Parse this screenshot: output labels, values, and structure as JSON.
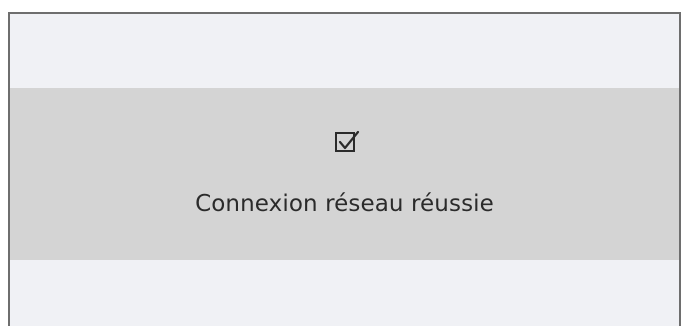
{
  "notification": {
    "icon": "checkbox-checked-icon",
    "message": "Connexion réseau réussie"
  },
  "colors": {
    "panel_background": "#f0f1f5",
    "banner_background": "#d4d4d4",
    "border": "#6e6e6e",
    "text": "#2b2b2b"
  }
}
